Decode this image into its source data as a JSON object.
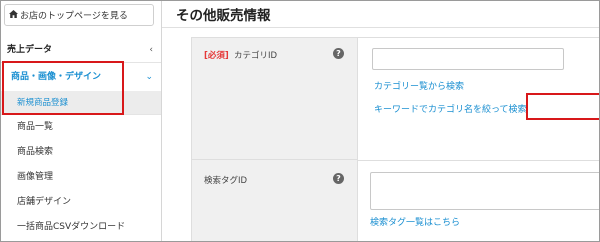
{
  "sidebar": {
    "top_button": "お店のトップページを見る",
    "sales_data": "売上データ",
    "sales_chevron": "‹",
    "category": "商品・画像・デザイン",
    "category_chevron": "⌄",
    "items": [
      "新規商品登録",
      "商品一覧",
      "商品検索",
      "画像管理",
      "店舗デザイン",
      "一括商品CSVダウンロード"
    ]
  },
  "main": {
    "heading": "その他販売情報",
    "category_field": {
      "required_tag": "[必須]",
      "label": "カテゴリID",
      "value": "",
      "link_list": "カテゴリー覧から検索",
      "link_keyword": "キーワードでカテゴリ名を絞って検索"
    },
    "search_tag_field": {
      "label": "検索タグID",
      "value": "",
      "link_list": "検索タグ一覧はこちら"
    }
  },
  "colors": {
    "accent": "#1a8fd1",
    "highlight": "#d8181a",
    "required": "#e53838"
  }
}
